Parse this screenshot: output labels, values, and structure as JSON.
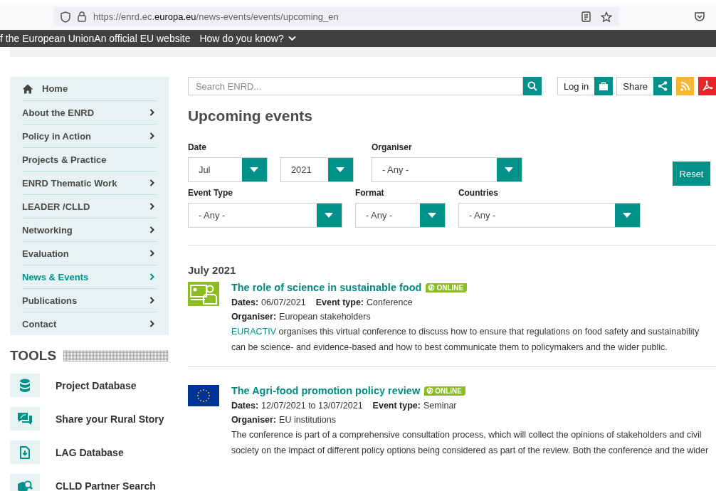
{
  "browser": {
    "url_prefix": "https://enrd.ec.",
    "url_domain": "europa.eu",
    "url_path": "/news-events/events/upcoming_en"
  },
  "eu_bar": {
    "text": "f the European UnionAn official EU website",
    "link": "How do you know?"
  },
  "sidebar": {
    "items": [
      {
        "label": "Home",
        "kind": "home",
        "expandable": false,
        "selected": false
      },
      {
        "label": "About the ENRD",
        "kind": "item",
        "expandable": true,
        "selected": false
      },
      {
        "label": "Policy in Action",
        "kind": "item",
        "expandable": true,
        "selected": false
      },
      {
        "label": "Projects & Practice",
        "kind": "item",
        "expandable": false,
        "selected": false
      },
      {
        "label": "ENRD Thematic Work",
        "kind": "item",
        "expandable": true,
        "selected": false
      },
      {
        "label": "LEADER /CLLD",
        "kind": "item",
        "expandable": true,
        "selected": false
      },
      {
        "label": "Networking",
        "kind": "item",
        "expandable": true,
        "selected": false
      },
      {
        "label": "Evaluation",
        "kind": "item",
        "expandable": true,
        "selected": false
      },
      {
        "label": "News & Events",
        "kind": "item",
        "expandable": true,
        "selected": true
      },
      {
        "label": "Publications",
        "kind": "item",
        "expandable": true,
        "selected": false
      },
      {
        "label": "Contact",
        "kind": "item",
        "expandable": true,
        "selected": false
      }
    ]
  },
  "tools": {
    "title": "TOOLS",
    "items": [
      {
        "label": "Project Database",
        "kind": "database"
      },
      {
        "label": "Share your Rural Story",
        "kind": "chat"
      },
      {
        "label": "LAG Database",
        "kind": "download"
      },
      {
        "label": "CLLD Partner Search",
        "kind": "search"
      }
    ]
  },
  "search": {
    "placeholder": "Search ENRD..."
  },
  "actions": {
    "login": "Log in",
    "share": "Share"
  },
  "page_title": "Upcoming events",
  "filters": {
    "rows": [
      [
        {
          "label": "Date",
          "selects": [
            "Jul",
            "2021"
          ]
        },
        {
          "label": "Organiser",
          "selects": [
            "- Any -"
          ]
        }
      ],
      [
        {
          "label": "Event Type",
          "selects": [
            "- Any -"
          ]
        },
        {
          "label": "Format",
          "selects": [
            "- Any -"
          ]
        },
        {
          "label": "Countries",
          "selects": [
            "- Any -"
          ]
        }
      ]
    ],
    "reset": "Reset"
  },
  "month": "July 2021",
  "events": [
    {
      "kind": "online-meeting",
      "title": "The role of science in sustainable food",
      "badge": "ONLINE",
      "dates_label": "Dates:",
      "dates": "06/07/2021",
      "type_label": "Event type:",
      "type": "Conference",
      "organiser_label": "Organiser:",
      "organiser": "European stakeholders",
      "description_link": "EURACTIV",
      "description": " organises this virtual conference to discuss how to ensure that regulations on food safety and sustainability can be science- and evidence-based and how to best communicate them to policymakers and the wider public."
    },
    {
      "kind": "eu-flag",
      "title": "The Agri-food promotion policy review",
      "badge": "ONLINE",
      "dates_label": "Dates:",
      "dates": "12/07/2021 to 13/07/2021",
      "type_label": "Event type:",
      "type": "Seminar",
      "organiser_label": "Organiser:",
      "organiser": "EU institutions",
      "description": "The conference is part of a comprehensive consultation process, which will collect the opinions of stakeholders and civil society on the impact of different policy options being considered as part of the review. Both the conference and the wider"
    }
  ]
}
